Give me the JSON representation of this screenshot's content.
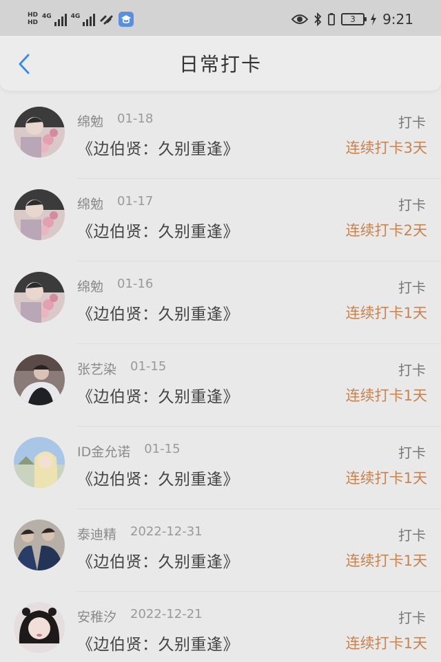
{
  "status_bar": {
    "hd1": "HD",
    "hd2": "HD",
    "net1": "4G",
    "net2": "4G",
    "battery": "3",
    "time": "9:21"
  },
  "header": {
    "title": "日常打卡"
  },
  "colors": {
    "accent": "#3a8de6",
    "streak": "#c8824e"
  },
  "entries": [
    {
      "name": "绵勉",
      "date": "01-18",
      "title": "《边伯贤：久别重逢》",
      "action": "打卡",
      "streak": "连续打卡3天"
    },
    {
      "name": "绵勉",
      "date": "01-17",
      "title": "《边伯贤：久别重逢》",
      "action": "打卡",
      "streak": "连续打卡2天"
    },
    {
      "name": "绵勉",
      "date": "01-16",
      "title": "《边伯贤：久别重逢》",
      "action": "打卡",
      "streak": "连续打卡1天"
    },
    {
      "name": "张艺染",
      "date": "01-15",
      "title": "《边伯贤：久别重逢》",
      "action": "打卡",
      "streak": "连续打卡1天"
    },
    {
      "name": "ID金允诺",
      "date": "01-15",
      "title": "《边伯贤：久别重逢》",
      "action": "打卡",
      "streak": "连续打卡1天"
    },
    {
      "name": "泰迪精",
      "date": "2022-12-31",
      "title": "《边伯贤：久别重逢》",
      "action": "打卡",
      "streak": "连续打卡1天"
    },
    {
      "name": "安稚汐",
      "date": "2022-12-21",
      "title": "《边伯贤：久别重逢》",
      "action": "打卡",
      "streak": "连续打卡1天"
    }
  ]
}
